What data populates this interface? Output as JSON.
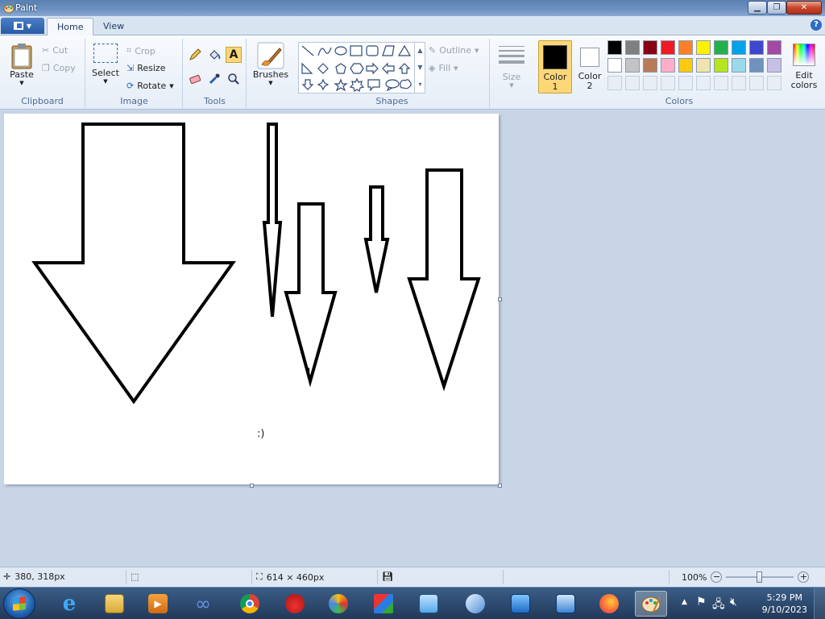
{
  "window": {
    "title": "Paint"
  },
  "tabs": [
    {
      "label": "Home",
      "active": true
    },
    {
      "label": "View",
      "active": false
    }
  ],
  "ribbon": {
    "clipboard": {
      "label": "Clipboard",
      "paste": "Paste",
      "cut": "Cut",
      "copy": "Copy"
    },
    "image": {
      "label": "Image",
      "select": "Select",
      "crop": "Crop",
      "resize": "Resize",
      "rotate": "Rotate"
    },
    "tools": {
      "label": "Tools"
    },
    "brushes": {
      "label": "Brushes"
    },
    "shapes": {
      "label": "Shapes",
      "outline": "Outline",
      "fill": "Fill"
    },
    "size": {
      "label": "Size"
    },
    "colors": {
      "label": "Colors",
      "color1": "Color\n1",
      "color1_a": "Color",
      "color1_b": "1",
      "color2_a": "Color",
      "color2_b": "2",
      "edit": "Edit",
      "edit_b": "colors",
      "primary": "#000000",
      "secondary": "#ffffff",
      "palette_row1": [
        "#000000",
        "#7f7f7f",
        "#880015",
        "#ed1c24",
        "#ff7f27",
        "#fff200",
        "#22b14c",
        "#00a2e8",
        "#3f48cc",
        "#a349a4"
      ],
      "palette_row2": [
        "#ffffff",
        "#c3c3c3",
        "#b97a57",
        "#ffaec9",
        "#ffc90e",
        "#efe4b0",
        "#b5e61d",
        "#99d9ea",
        "#7092be",
        "#c8bfe7"
      ]
    }
  },
  "canvas": {
    "text": ":)"
  },
  "statusbar": {
    "cursor_pos": "380, 318px",
    "canvas_size": "614 × 460px",
    "zoom": "100%"
  },
  "taskbar": {
    "time": "5:29 PM",
    "date": "9/10/2023"
  }
}
